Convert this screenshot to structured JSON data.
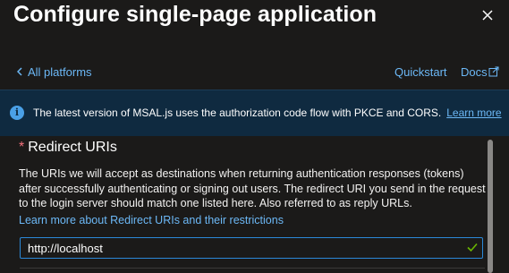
{
  "header": {
    "title": "Configure single-page application",
    "close_icon": "close-icon"
  },
  "nav": {
    "back_label": "All platforms",
    "quickstart_label": "Quickstart",
    "docs_label": "Docs"
  },
  "info_banner": {
    "icon": "info-icon",
    "message": "The latest version of MSAL.js uses the authorization code flow with PKCE and CORS.",
    "link_label": "Learn more"
  },
  "redirect": {
    "required_mark": "*",
    "title": "Redirect URIs",
    "description": "The URIs we will accept as destinations when returning authentication responses (tokens) after successfully authenticating or signing out users. The redirect URI you send in the request to the login server should match one listed here. Also referred to as reply URLs.",
    "learn_link": "Learn more about Redirect URIs and their restrictions",
    "input_value": "http://localhost"
  },
  "colors": {
    "background": "#1b1a19",
    "link": "#6cb8f6",
    "banner": "#0f2a40",
    "input_border": "#2b88d8",
    "check": "#6bb700",
    "required": "#f1707b"
  }
}
